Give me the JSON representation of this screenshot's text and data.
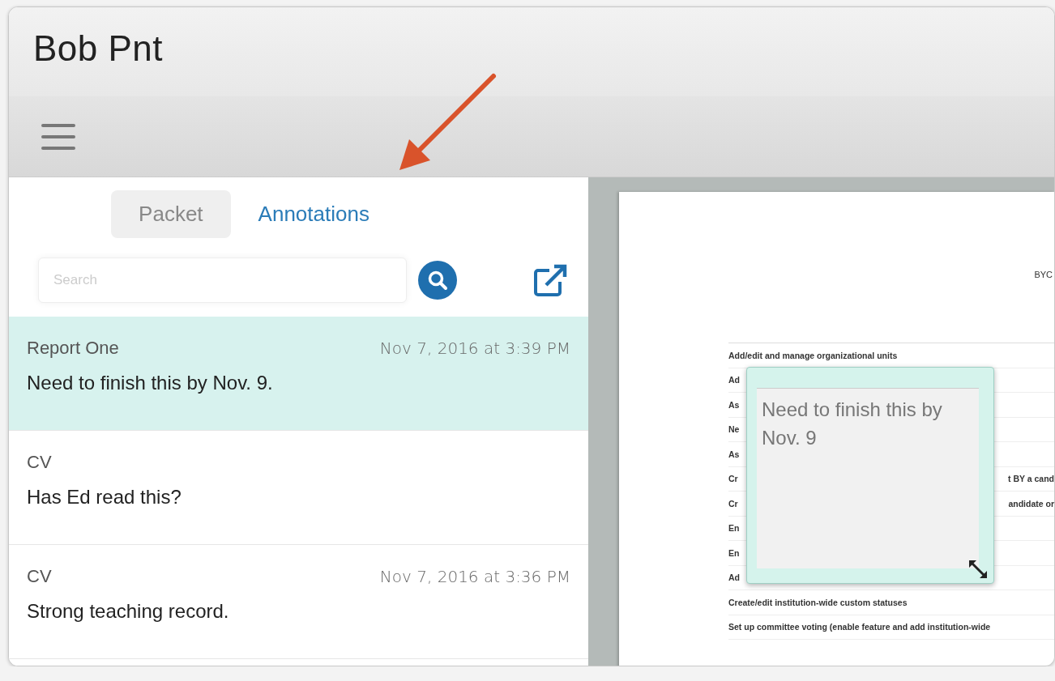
{
  "window": {
    "title": "Bob Pnt"
  },
  "tabs": [
    {
      "label": "Packet",
      "selected": false
    },
    {
      "label": "Annotations",
      "selected": true
    }
  ],
  "search": {
    "placeholder": "Search"
  },
  "annotations": [
    {
      "source": "Report One",
      "date": "Nov 7, 2016 at 3:39 PM",
      "text": "Need to finish this by Nov. 9.",
      "selected": true
    },
    {
      "source": "CV",
      "text": "Has Ed read this?",
      "selected": false
    },
    {
      "source": "CV",
      "date": "Nov 7, 2016 at 3:36 PM",
      "text": "Strong teaching record.",
      "selected": false
    }
  ],
  "document": {
    "heading_fragment": "BYC",
    "rows": [
      {
        "left": "Add/edit and manage organizational units"
      },
      {
        "left": "Ad"
      },
      {
        "left": "As"
      },
      {
        "left": "Ne"
      },
      {
        "left": "As"
      },
      {
        "left": "Cr",
        "right": "t BY a cand"
      },
      {
        "left": "Cr",
        "right": "andidate or"
      },
      {
        "left": "En"
      },
      {
        "left": "En"
      },
      {
        "left": "Ad"
      },
      {
        "left": "Create/edit institution-wide custom statuses"
      },
      {
        "left": "Set up committee voting (enable feature and add institution-wide"
      }
    ]
  },
  "note_popup": {
    "text": "Need to finish this by Nov. 9"
  }
}
